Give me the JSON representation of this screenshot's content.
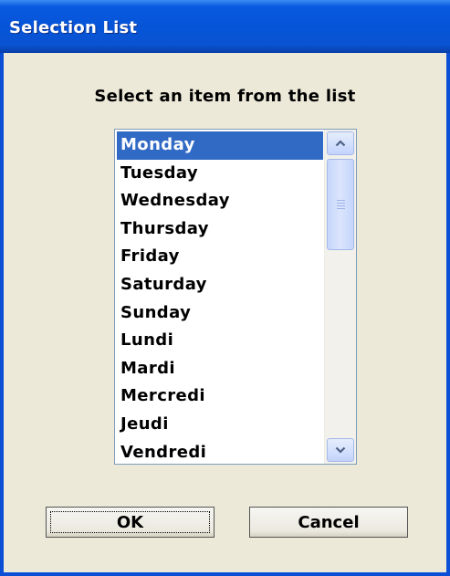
{
  "window": {
    "title": "Selection List"
  },
  "prompt": "Select an item from the list",
  "list": {
    "selected_index": 0,
    "items": [
      "Monday",
      "Tuesday",
      "Wednesday",
      "Thursday",
      "Friday",
      "Saturday",
      "Sunday",
      "Lundi",
      "Mardi",
      "Mercredi",
      "Jeudi",
      "Vendredi"
    ]
  },
  "buttons": {
    "ok_label": "OK",
    "cancel_label": "Cancel"
  },
  "colors": {
    "titlebar": "#0554d8",
    "selection": "#316ac5",
    "dialog_bg": "#ece9d8"
  },
  "icons": {
    "scroll_up": "chevron-up-icon",
    "scroll_down": "chevron-down-icon"
  }
}
